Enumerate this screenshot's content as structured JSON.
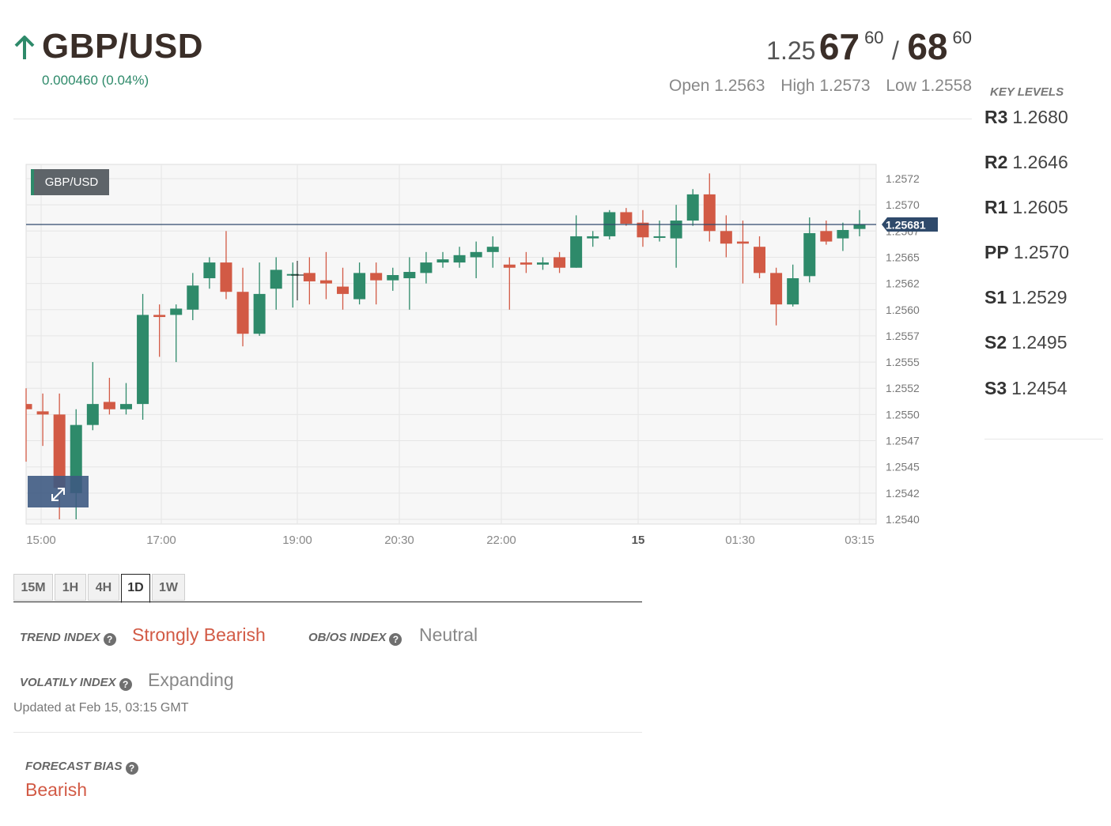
{
  "header": {
    "pair": "GBP/USD",
    "change": "0.000460 (0.04%)",
    "price": {
      "bid_prefix": "1.25",
      "bid_big": "67",
      "bid_sup": "60",
      "separator": "/",
      "ask_big": "68",
      "ask_sup": "60"
    },
    "open": "Open 1.2563",
    "high": "High 1.2573",
    "low": "Low 1.2558"
  },
  "key_levels": {
    "title": "KEY LEVELS",
    "levels": [
      {
        "name": "R3",
        "value": "1.2680"
      },
      {
        "name": "R2",
        "value": "1.2646"
      },
      {
        "name": "R1",
        "value": "1.2605"
      },
      {
        "name": "PP",
        "value": "1.2570"
      },
      {
        "name": "S1",
        "value": "1.2529"
      },
      {
        "name": "S2",
        "value": "1.2495"
      },
      {
        "name": "S3",
        "value": "1.2454"
      }
    ]
  },
  "chart_badge": "GBP/USD",
  "timeframes": {
    "tabs": [
      "15M",
      "1H",
      "4H",
      "1D",
      "1W"
    ],
    "active": "1D"
  },
  "indexes": {
    "trend_label": "TREND INDEX",
    "trend_value": "Strongly Bearish",
    "obos_label": "OB/OS INDEX",
    "obos_value": "Neutral",
    "volatility_label": "VOLATILY INDEX",
    "volatility_value": "Expanding",
    "updated": "Updated at Feb 15, 03:15 GMT",
    "forecast_label": "FORECAST BIAS",
    "forecast_value": "Bearish"
  },
  "icons": {
    "arrow": "arrow-up-icon",
    "help": "question-circle-icon",
    "expand": "expand-arrows-icon"
  },
  "colors": {
    "bull": "#2e8a6a",
    "bear": "#d25a45",
    "price_line": "#2f4a6b"
  },
  "chart_data": {
    "type": "candlestick",
    "title": "GBP/USD",
    "ylim": [
      1.254,
      1.25725
    ],
    "y_ticks": [
      "1.2572",
      "1.2570",
      "1.2567",
      "1.2565",
      "1.2562",
      "1.2560",
      "1.2557",
      "1.2555",
      "1.2552",
      "1.2550",
      "1.2547",
      "1.2545",
      "1.2542",
      "1.2540"
    ],
    "x_ticks": [
      "15:00",
      "17:00",
      "19:00",
      "20:30",
      "22:00",
      "15",
      "01:30",
      "03:15"
    ],
    "last_price": "1.25681",
    "candles": [
      {
        "o": 1.2551,
        "h": 1.25525,
        "l": 1.25455,
        "c": 1.25505
      },
      {
        "o": 1.25503,
        "h": 1.2552,
        "l": 1.2547,
        "c": 1.255
      },
      {
        "o": 1.255,
        "h": 1.2552,
        "l": 1.254,
        "c": 1.2543
      },
      {
        "o": 1.25425,
        "h": 1.25505,
        "l": 1.254,
        "c": 1.2549
      },
      {
        "o": 1.2549,
        "h": 1.2555,
        "l": 1.25485,
        "c": 1.2551
      },
      {
        "o": 1.25512,
        "h": 1.25535,
        "l": 1.255,
        "c": 1.25505
      },
      {
        "o": 1.25505,
        "h": 1.2553,
        "l": 1.255,
        "c": 1.2551
      },
      {
        "o": 1.2551,
        "h": 1.25615,
        "l": 1.25495,
        "c": 1.25595
      },
      {
        "o": 1.25595,
        "h": 1.25605,
        "l": 1.25555,
        "c": 1.25593
      },
      {
        "o": 1.25595,
        "h": 1.25605,
        "l": 1.2555,
        "c": 1.25601
      },
      {
        "o": 1.256,
        "h": 1.25635,
        "l": 1.2559,
        "c": 1.25623
      },
      {
        "o": 1.2563,
        "h": 1.2565,
        "l": 1.2562,
        "c": 1.25645
      },
      {
        "o": 1.25645,
        "h": 1.25675,
        "l": 1.2561,
        "c": 1.25617
      },
      {
        "o": 1.25617,
        "h": 1.2564,
        "l": 1.25565,
        "c": 1.25577
      },
      {
        "o": 1.25577,
        "h": 1.25645,
        "l": 1.25575,
        "c": 1.25615
      },
      {
        "o": 1.2562,
        "h": 1.2565,
        "l": 1.256,
        "c": 1.25638
      },
      {
        "o": 1.25634,
        "h": 1.25645,
        "l": 1.25602,
        "c": 1.25634
      },
      {
        "o": 1.25635,
        "h": 1.2565,
        "l": 1.25605,
        "c": 1.25627
      },
      {
        "o": 1.25628,
        "h": 1.25655,
        "l": 1.2561,
        "c": 1.25625
      },
      {
        "o": 1.25622,
        "h": 1.2564,
        "l": 1.256,
        "c": 1.25615
      },
      {
        "o": 1.2561,
        "h": 1.25645,
        "l": 1.25605,
        "c": 1.25635
      },
      {
        "o": 1.25635,
        "h": 1.25645,
        "l": 1.25605,
        "c": 1.25628
      },
      {
        "o": 1.25628,
        "h": 1.2564,
        "l": 1.25618,
        "c": 1.25633
      },
      {
        "o": 1.2563,
        "h": 1.2565,
        "l": 1.256,
        "c": 1.25636
      },
      {
        "o": 1.25635,
        "h": 1.25655,
        "l": 1.25625,
        "c": 1.25645
      },
      {
        "o": 1.25645,
        "h": 1.25655,
        "l": 1.2564,
        "c": 1.25648
      },
      {
        "o": 1.25645,
        "h": 1.2566,
        "l": 1.2564,
        "c": 1.25652
      },
      {
        "o": 1.2565,
        "h": 1.25665,
        "l": 1.2563,
        "c": 1.25655
      },
      {
        "o": 1.25655,
        "h": 1.2567,
        "l": 1.2564,
        "c": 1.2566
      },
      {
        "o": 1.25643,
        "h": 1.2565,
        "l": 1.256,
        "c": 1.2564
      },
      {
        "o": 1.25645,
        "h": 1.25655,
        "l": 1.25635,
        "c": 1.25643
      },
      {
        "o": 1.25643,
        "h": 1.2565,
        "l": 1.25638,
        "c": 1.25645
      },
      {
        "o": 1.2565,
        "h": 1.25655,
        "l": 1.25635,
        "c": 1.2564
      },
      {
        "o": 1.2564,
        "h": 1.2569,
        "l": 1.2564,
        "c": 1.2567
      },
      {
        "o": 1.25668,
        "h": 1.25675,
        "l": 1.2566,
        "c": 1.2567
      },
      {
        "o": 1.2567,
        "h": 1.25695,
        "l": 1.25667,
        "c": 1.25693
      },
      {
        "o": 1.25693,
        "h": 1.25697,
        "l": 1.2568,
        "c": 1.25682
      },
      {
        "o": 1.25683,
        "h": 1.25695,
        "l": 1.2566,
        "c": 1.25669
      },
      {
        "o": 1.25669,
        "h": 1.25685,
        "l": 1.25665,
        "c": 1.2567
      },
      {
        "o": 1.25668,
        "h": 1.257,
        "l": 1.2564,
        "c": 1.25685
      },
      {
        "o": 1.25685,
        "h": 1.25715,
        "l": 1.2568,
        "c": 1.2571
      },
      {
        "o": 1.2571,
        "h": 1.2573,
        "l": 1.25665,
        "c": 1.25675
      },
      {
        "o": 1.25675,
        "h": 1.2569,
        "l": 1.2565,
        "c": 1.25663
      },
      {
        "o": 1.25665,
        "h": 1.25685,
        "l": 1.25625,
        "c": 1.25663
      },
      {
        "o": 1.2566,
        "h": 1.2567,
        "l": 1.2563,
        "c": 1.25635
      },
      {
        "o": 1.25635,
        "h": 1.2564,
        "l": 1.25585,
        "c": 1.25605
      },
      {
        "o": 1.25605,
        "h": 1.25643,
        "l": 1.25603,
        "c": 1.2563
      },
      {
        "o": 1.25632,
        "h": 1.25688,
        "l": 1.25626,
        "c": 1.25673
      },
      {
        "o": 1.25675,
        "h": 1.25685,
        "l": 1.25662,
        "c": 1.25665
      },
      {
        "o": 1.25668,
        "h": 1.25683,
        "l": 1.25656,
        "c": 1.25676
      },
      {
        "o": 1.25677,
        "h": 1.25695,
        "l": 1.2567,
        "c": 1.25681
      }
    ]
  }
}
